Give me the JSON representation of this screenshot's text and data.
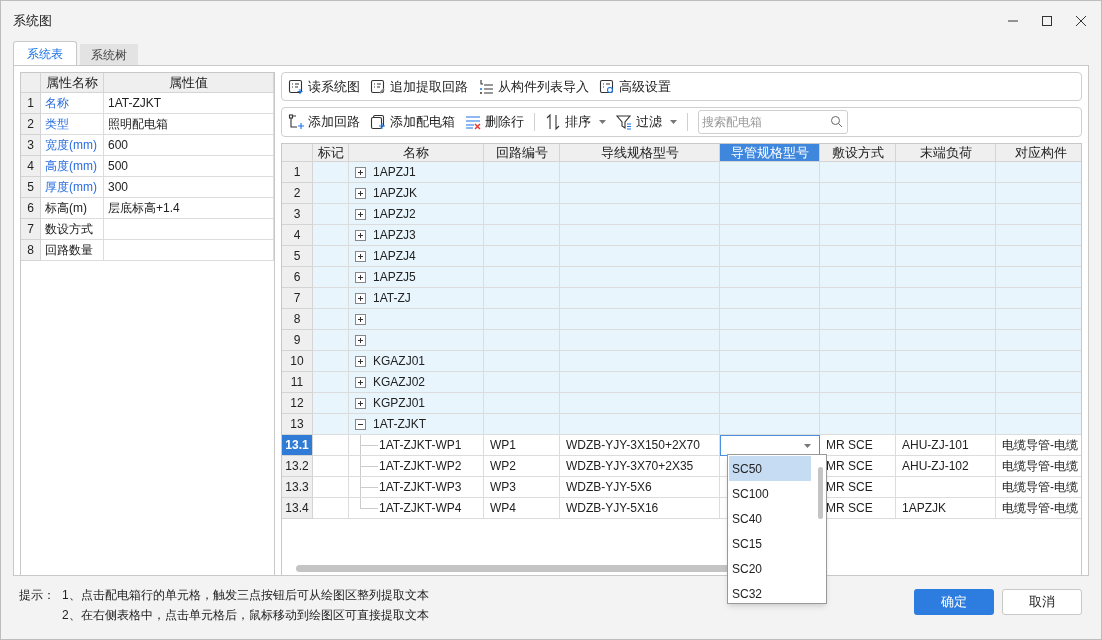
{
  "window": {
    "title": "系统图"
  },
  "tabs": [
    {
      "label": "系统表",
      "selected": true
    },
    {
      "label": "系统树",
      "selected": false
    }
  ],
  "properties": {
    "columns": [
      "属性名称",
      "属性值"
    ],
    "rows": [
      {
        "index": "1",
        "name": "名称",
        "value": "1AT-ZJKT",
        "linked": true
      },
      {
        "index": "2",
        "name": "类型",
        "value": "照明配电箱",
        "linked": true
      },
      {
        "index": "3",
        "name": "宽度(mm)",
        "value": "600",
        "linked": true
      },
      {
        "index": "4",
        "name": "高度(mm)",
        "value": "500",
        "linked": true
      },
      {
        "index": "5",
        "name": "厚度(mm)",
        "value": "300",
        "linked": true
      },
      {
        "index": "6",
        "name": "标高(m)",
        "value": "层底标高+1.4",
        "linked": false
      },
      {
        "index": "7",
        "name": "数设方式",
        "linked": false
      },
      {
        "index": "8",
        "name": "回路数量",
        "linked": false
      }
    ]
  },
  "toolbar_1": [
    {
      "label": "读系统图",
      "kind": "read"
    },
    {
      "label": "追加提取回路",
      "kind": "append"
    },
    {
      "label": "从构件列表导入",
      "kind": "import"
    },
    {
      "label": "高级设置",
      "kind": "settings"
    }
  ],
  "toolbar_2": {
    "items": [
      {
        "label": "添加回路",
        "kind": "add-circuit",
        "dropdown": false
      },
      {
        "label": "添加配电箱",
        "kind": "add-box",
        "dropdown": false
      },
      {
        "label": "删除行",
        "kind": "delete",
        "dropdown": false
      },
      {
        "label": "排序",
        "kind": "sort",
        "dropdown": true
      },
      {
        "label": "过滤",
        "kind": "filter",
        "dropdown": true
      }
    ],
    "search": {
      "placeholder": "搜索配电箱"
    }
  },
  "grid": {
    "columns": [
      {
        "label": "标记",
        "selected": false
      },
      {
        "label": "名称",
        "selected": false
      },
      {
        "label": "回路编号",
        "selected": false
      },
      {
        "label": "导线规格型号",
        "selected": false
      },
      {
        "label": "导管规格型号",
        "selected": true
      },
      {
        "label": "敷设方式",
        "selected": false
      },
      {
        "label": "末端负荷",
        "selected": false
      },
      {
        "label": "对应构件",
        "selected": false
      }
    ],
    "rows": [
      {
        "index": "1",
        "name": "1APZJ1",
        "expanded": false
      },
      {
        "index": "2",
        "name": "1APZJK",
        "expanded": false
      },
      {
        "index": "3",
        "name": "1APZJ2",
        "expanded": false
      },
      {
        "index": "4",
        "name": "1APZJ3",
        "expanded": false
      },
      {
        "index": "5",
        "name": "1APZJ4",
        "expanded": false
      },
      {
        "index": "6",
        "name": "1APZJ5",
        "expanded": false
      },
      {
        "index": "7",
        "name": "1AT-ZJ",
        "expanded": false
      },
      {
        "index": "8",
        "expanded": false
      },
      {
        "index": "9",
        "expanded": false
      },
      {
        "index": "10",
        "name": "KGAZJ01",
        "expanded": false
      },
      {
        "index": "11",
        "name": "KGAZJ02",
        "expanded": false
      },
      {
        "index": "12",
        "name": "KGPZJ01",
        "expanded": false
      },
      {
        "index": "13",
        "name": "1AT-ZJKT",
        "expanded": true,
        "children": [
          {
            "index": "13.1",
            "name": "1AT-ZJKT-WP1",
            "circuit": "WP1",
            "wire": "WDZB-YJY-3X150+2X70",
            "editing": true,
            "selected": true,
            "method": "MR SCE",
            "load": "AHU-ZJ-101",
            "component": "电缆导管-电缆"
          },
          {
            "index": "13.2",
            "name": "1AT-ZJKT-WP2",
            "circuit": "WP2",
            "wire": "WDZB-YJY-3X70+2X35",
            "editing": false,
            "selected": false,
            "method": "MR SCE",
            "load": "AHU-ZJ-102",
            "component": "电缆导管-电缆"
          },
          {
            "index": "13.3",
            "name": "1AT-ZJKT-WP3",
            "circuit": "WP3",
            "wire": "WDZB-YJY-5X6",
            "editing": false,
            "selected": false,
            "method": "MR SCE",
            "component": "电缆导管-电缆"
          },
          {
            "index": "13.4",
            "name": "1AT-ZJKT-WP4",
            "circuit": "WP4",
            "wire": "WDZB-YJY-5X16",
            "editing": false,
            "selected": false,
            "method": "MR SCE",
            "load": "1APZJK",
            "component": "电缆导管-电缆"
          }
        ]
      }
    ]
  },
  "dropdown": {
    "options": [
      {
        "label": "SC50",
        "selected": true
      },
      {
        "label": "SC100",
        "selected": false
      },
      {
        "label": "SC40",
        "selected": false
      },
      {
        "label": "SC15",
        "selected": false
      },
      {
        "label": "SC20",
        "selected": false
      },
      {
        "label": "SC32",
        "selected": false
      }
    ]
  },
  "hint": {
    "label": "提示：",
    "lines": [
      "1、点击配电箱行的单元格，触发三点按钮后可从绘图区整列提取文本",
      "2、在右侧表格中，点击单元格后，鼠标移动到绘图区可直接提取文本"
    ]
  },
  "buttons": [
    {
      "label": "确定",
      "primary": true
    },
    {
      "label": "取消",
      "primary": false
    }
  ]
}
